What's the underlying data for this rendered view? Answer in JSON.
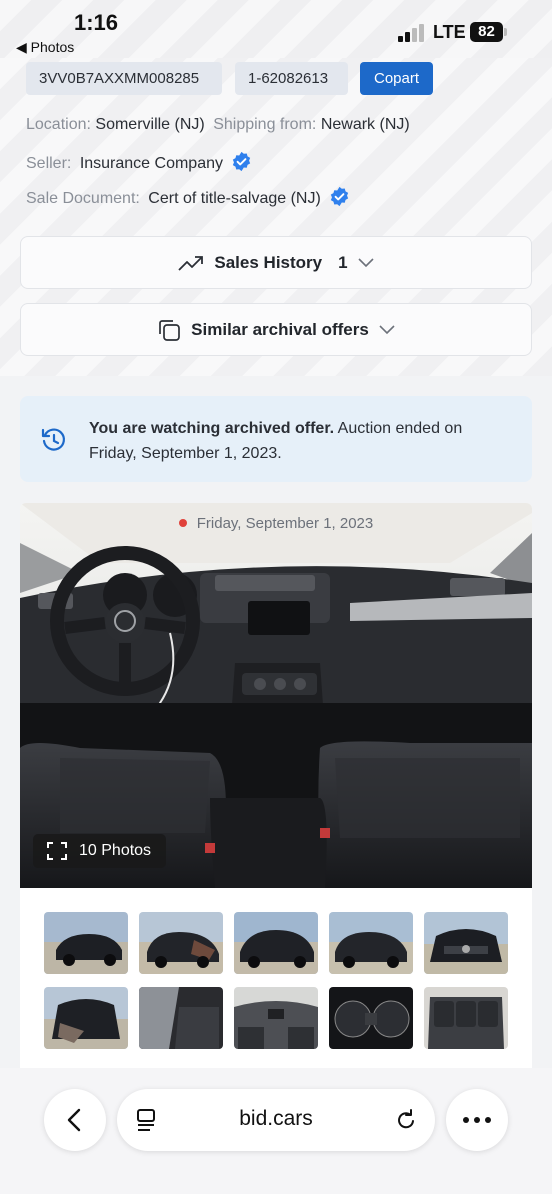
{
  "status_bar": {
    "time": "1:16",
    "back_label": "◀ Photos",
    "network": "LTE",
    "battery": "82"
  },
  "lot": {
    "vin": "3VV0B7AXXMM008285",
    "lot_number": "1-62082613",
    "auction_button": "Copart",
    "location_label": "Location:",
    "location_value": "Somerville (NJ)",
    "shipping_label": "Shipping from:",
    "shipping_value": "Newark (NJ)",
    "seller_label": "Seller:",
    "seller_value": "Insurance Company",
    "sale_doc_label": "Sale Document:",
    "sale_doc_value": "Cert of title-salvage (NJ)"
  },
  "accordions": {
    "sales_history_label": "Sales History",
    "sales_history_count": "1",
    "similar_label": "Similar archival offers"
  },
  "alert": {
    "bold_text": "You are watching archived offer.",
    "rest_text": " Auction ended on Friday, September 1, 2023."
  },
  "gallery": {
    "date": "Friday, September 1, 2023",
    "photos_button": "10 Photos",
    "thumbnails": [
      "thumb-1",
      "thumb-2",
      "thumb-3",
      "thumb-4",
      "thumb-5",
      "thumb-6",
      "thumb-7",
      "thumb-8",
      "thumb-9",
      "thumb-10"
    ]
  },
  "browser": {
    "url": "bid.cars"
  },
  "colors": {
    "accent_blue": "#1d69c9",
    "alert_bg": "#e6f0f9",
    "verified_blue": "#2f80ed",
    "date_dot": "#e0413a"
  }
}
